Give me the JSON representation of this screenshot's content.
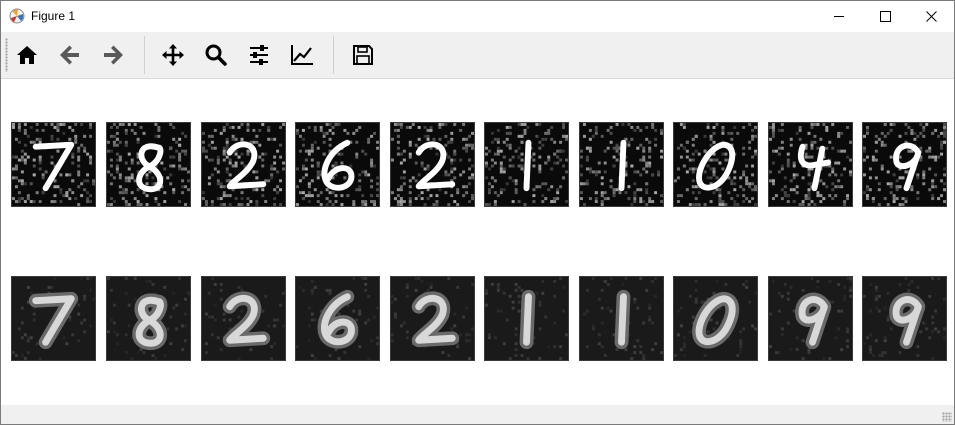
{
  "window": {
    "title": "Figure 1"
  },
  "titlebar": {
    "icon": "matplotlib-icon",
    "controls": [
      "minimize-icon",
      "maximize-icon",
      "close-icon"
    ]
  },
  "toolbar": {
    "buttons": [
      {
        "name": "home-button",
        "icon": "home-icon"
      },
      {
        "name": "back-button",
        "icon": "arrow-left-icon"
      },
      {
        "name": "forward-button",
        "icon": "arrow-right-icon"
      },
      {
        "name": "pan-button",
        "icon": "move-icon"
      },
      {
        "name": "zoom-button",
        "icon": "magnifier-icon"
      },
      {
        "name": "subplots-button",
        "icon": "sliders-icon"
      },
      {
        "name": "edit-axes-button",
        "icon": "line-chart-icon"
      },
      {
        "name": "save-button",
        "icon": "floppy-disk-icon"
      }
    ]
  },
  "figure": {
    "rows": [
      {
        "role": "noisy-input",
        "digits": [
          "7",
          "8",
          "2",
          "6",
          "2",
          "1",
          "1",
          "0",
          "4",
          "9"
        ]
      },
      {
        "role": "denoised-output",
        "digits": [
          "7",
          "8",
          "2",
          "6",
          "2",
          "1",
          "1",
          "0",
          "9",
          "9"
        ]
      }
    ],
    "colors": {
      "panel_background": "#0a0a0a",
      "stroke_noisy": "#ffffff",
      "stroke_denoised": "#d8d8d8"
    }
  }
}
